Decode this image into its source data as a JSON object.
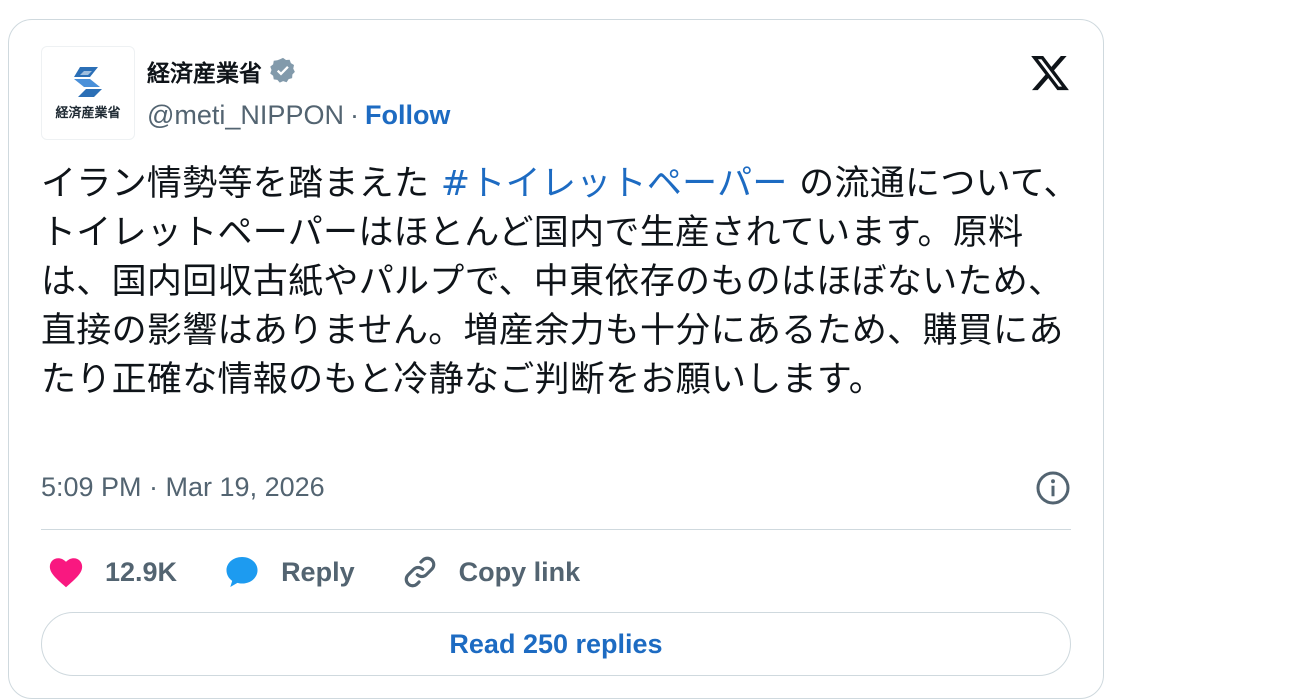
{
  "author": {
    "display_name": "経済産業省",
    "avatar_caption": "経済産業省",
    "handle": "@meti_NIPPON",
    "separator": "·",
    "follow_label": "Follow",
    "verified": true
  },
  "tweet": {
    "text_before": "イラン情勢等を踏まえた ",
    "hashtag": "#トイレットペーパー",
    "text_after": " の流通について、トイレットペーパーはほとんど国内で生産されています。原料は、国内回収古紙やパルプで、中東依存のものはほぼないため、直接の影響はありません。増産余力も十分にあるため、購買にあたり正確な情報のもと冷静なご判断をお願いします。",
    "timestamp": "5:09 PM · Mar 19, 2026"
  },
  "actions": {
    "like_count": "12.9K",
    "reply_label": "Reply",
    "copy_link_label": "Copy link"
  },
  "footer": {
    "read_replies_label": "Read 250 replies"
  },
  "colors": {
    "link": "#1d6bc2",
    "heart": "#f91880",
    "reply_bubble": "#1d9bf0",
    "muted_text": "#536471",
    "border": "#cfd9de",
    "logo_blue": "#2b6fb6"
  },
  "icons": {
    "verified": "verified-badge-icon",
    "x_logo": "x-logo-icon",
    "info": "info-icon",
    "like": "heart-icon",
    "reply": "speech-bubble-icon",
    "copy_link": "link-icon"
  }
}
